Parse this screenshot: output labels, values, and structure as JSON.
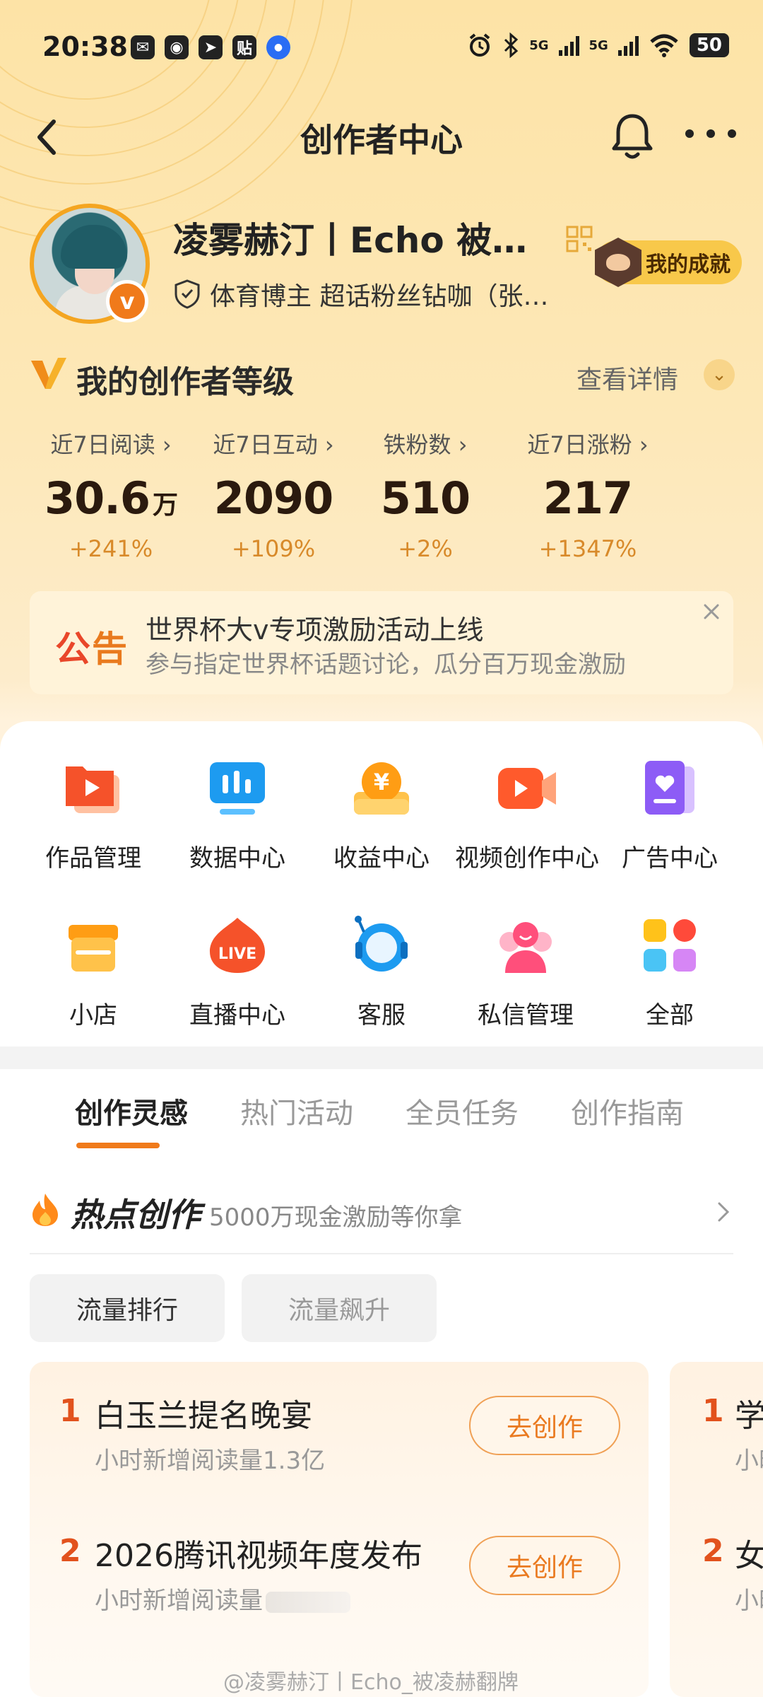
{
  "status_bar": {
    "time": "20:38",
    "app_icons": [
      "wechat-icon",
      "weibo-icon",
      "telegram-icon",
      "tieba-icon",
      "notification-dot-icon"
    ],
    "app_icon_glyphs": [
      "✉",
      "◉",
      "➤",
      "贴",
      "●"
    ],
    "network_1": "5G",
    "network_2": "5G",
    "battery": "50"
  },
  "nav": {
    "title": "创作者中心"
  },
  "profile": {
    "name": "凌雾赫汀丨Echo 被…",
    "verified_mark": "v",
    "tag": "体育博主 超话粉丝钻咖（张…",
    "achievement_label": "我的成就"
  },
  "level": {
    "title": "我的创作者等级",
    "detail_label": "查看详情"
  },
  "stats": [
    {
      "label": "近7日阅读",
      "value": "30.6",
      "unit": "万",
      "delta": "+241%"
    },
    {
      "label": "近7日互动",
      "value": "2090",
      "unit": "",
      "delta": "+109%"
    },
    {
      "label": "铁粉数",
      "value": "510",
      "unit": "",
      "delta": "+2%"
    },
    {
      "label": "近7日涨粉",
      "value": "217",
      "unit": "",
      "delta": "+1347%"
    }
  ],
  "notice": {
    "tag_part1": "公",
    "tag_part2": "告",
    "title": "世界杯大v专项激励活动上线",
    "subtitle": "参与指定世界杯话题讨论，瓜分百万现金激励"
  },
  "tools": [
    {
      "label": "作品管理",
      "icon": "works-manage-icon"
    },
    {
      "label": "数据中心",
      "icon": "data-center-icon"
    },
    {
      "label": "收益中心",
      "icon": "income-center-icon"
    },
    {
      "label": "视频创作中心",
      "icon": "video-creation-icon"
    },
    {
      "label": "广告中心",
      "icon": "ad-center-icon"
    },
    {
      "label": "小店",
      "icon": "shop-icon"
    },
    {
      "label": "直播中心",
      "icon": "live-center-icon"
    },
    {
      "label": "客服",
      "icon": "customer-service-icon"
    },
    {
      "label": "私信管理",
      "icon": "message-manage-icon"
    },
    {
      "label": "全部",
      "icon": "all-apps-icon"
    }
  ],
  "live_icon_text": "LIVE",
  "income_icon_text": "¥",
  "tabs": [
    "创作灵感",
    "热门活动",
    "全员任务",
    "创作指南"
  ],
  "hot": {
    "title": "热点创作",
    "subtitle": "5000万现金激励等你拿"
  },
  "filters": [
    "流量排行",
    "流量飙升"
  ],
  "rank_items": [
    {
      "rank": "1",
      "title": "白玉兰提名晚宴",
      "meta": "小时新增阅读量1.3亿",
      "button": "去创作"
    },
    {
      "rank": "2",
      "title": "2026腾讯视频年度发布",
      "meta": "小时新增阅读量",
      "button": "去创作"
    }
  ],
  "rank_items_peek": [
    {
      "rank": "1",
      "title": "学",
      "meta": "小时"
    },
    {
      "rank": "2",
      "title": "女",
      "meta": "小时"
    }
  ],
  "watermark": "@凌雾赫汀丨Echo_被凌赫翻牌",
  "colors": {
    "accent": "#f07a1a",
    "delta": "#d88a2a",
    "rank_number": "#e2521d",
    "notice_red": "#e9472a"
  }
}
